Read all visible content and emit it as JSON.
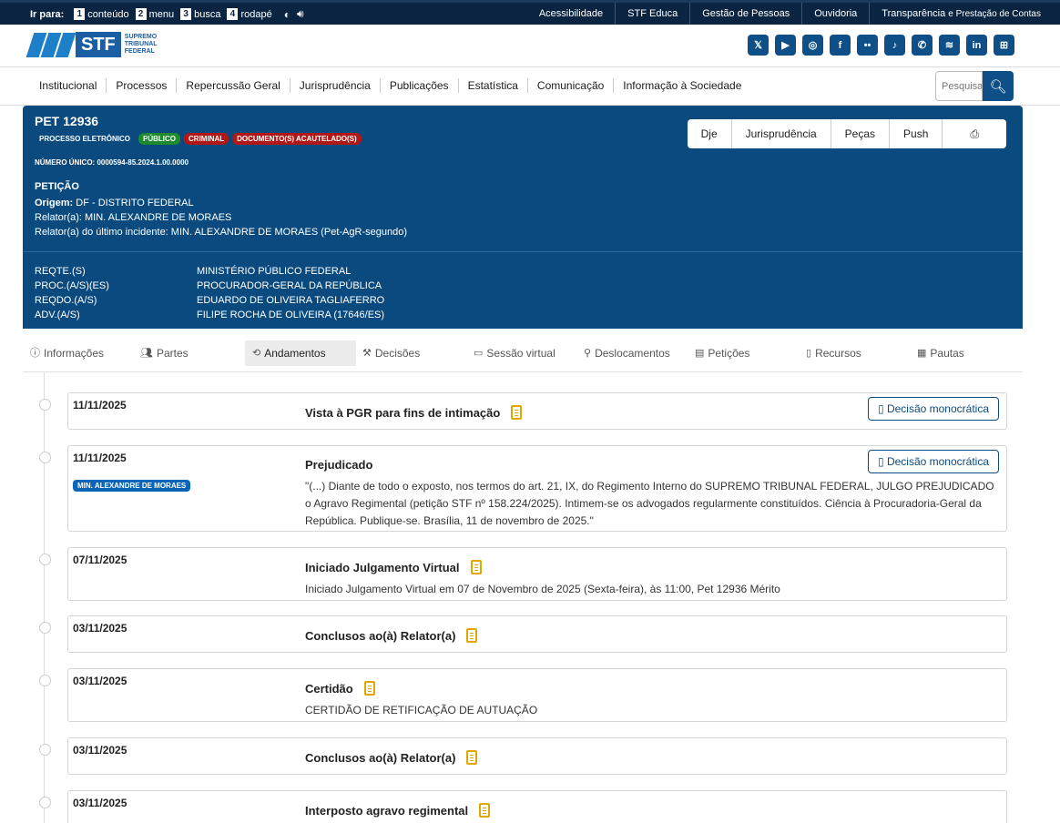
{
  "topbar": {
    "skip_label": "Ir para:",
    "skip": [
      {
        "num": "1",
        "label": "conteúdo"
      },
      {
        "num": "2",
        "label": "menu"
      },
      {
        "num": "3",
        "label": "busca"
      },
      {
        "num": "4",
        "label": "rodapé"
      }
    ],
    "links": [
      "Acessibilidade",
      "STF Educa",
      "Gestão de Pessoas",
      "Ouvidoria"
    ],
    "transparency_main": "Transparência",
    "transparency_small": "e Prestação de Contas"
  },
  "logo": {
    "text": "STF",
    "sub1": "SUPREMO",
    "sub2": "TRIBUNAL",
    "sub3": "FEDERAL"
  },
  "social": [
    "x-icon",
    "youtube-icon",
    "instagram-icon",
    "facebook-icon",
    "flickr-icon",
    "tiktok-icon",
    "whatsapp-icon",
    "spotify-icon",
    "linkedin-icon",
    "grid-icon"
  ],
  "nav": [
    "Institucional",
    "Processos",
    "Repercussão Geral",
    "Jurisprudência",
    "Publicações",
    "Estatística",
    "Comunicação",
    "Informação à Sociedade"
  ],
  "search": {
    "placeholder": "Pesquisar"
  },
  "process": {
    "title": "PET 12936",
    "type": "PROCESSO ELETRÔNICO",
    "badges": [
      "PÚBLICO",
      "CRIMINAL",
      "DOCUMENTO(S) ACAUTELADO(S)"
    ],
    "numero_unico": "NÚMERO ÚNICO: 0000594-85.2024.1.00.0000",
    "classe": "PETIÇÃO",
    "origem_label": "Origem:",
    "origem": "DF - DISTRITO FEDERAL",
    "relator": "Relator(a): MIN. ALEXANDRE DE MORAES",
    "relator_incidente": "Relator(a) do último incidente: MIN. ALEXANDRE DE MORAES (Pet-AgR-segundo)",
    "parties": [
      {
        "role": "REQTE.(S)",
        "name": "MINISTÉRIO PÚBLICO FEDERAL"
      },
      {
        "role": "PROC.(A/S)(ES)",
        "name": "PROCURADOR-GERAL DA REPÚBLICA"
      },
      {
        "role": "REQDO.(A/S)",
        "name": "EDUARDO DE OLIVEIRA TAGLIAFERRO"
      },
      {
        "role": "ADV.(A/S)",
        "name": "FILIPE ROCHA DE OLIVEIRA (17646/ES)"
      }
    ],
    "actions": [
      "Dje",
      "Jurisprudência",
      "Peças",
      "Push"
    ]
  },
  "tabs": [
    "Informações",
    "Partes",
    "Andamentos",
    "Decisões",
    "Sessão virtual",
    "Deslocamentos",
    "Petições",
    "Recursos",
    "Pautas"
  ],
  "entries": [
    {
      "date": "11/11/2025",
      "title": "Vista à PGR para fins de intimação",
      "button": "Decisão monocrática"
    },
    {
      "date": "11/11/2025",
      "title": "Prejudicado",
      "button": "Decisão monocrática",
      "tag": "MIN. ALEXANDRE DE MORAES",
      "desc": "\"(...) Diante de todo o exposto, nos termos do art. 21, IX, do Regimento Interno do SUPREMO TRIBUNAL FEDERAL, JULGO PREJUDICADO o Agravo Regimental (petição STF nº 158.224/2025). Intimem-se os advogados regularmente constituídos. Ciência à Procuradoria-Geral da República. Publique-se. Brasília, 11 de novembro de 2025.\""
    },
    {
      "date": "07/11/2025",
      "title": "Iniciado Julgamento Virtual",
      "desc": "Iniciado Julgamento Virtual em 07 de Novembro de 2025 (Sexta-feira), às 11:00, Pet 12936 Mérito"
    },
    {
      "date": "03/11/2025",
      "title": "Conclusos ao(à) Relator(a)"
    },
    {
      "date": "03/11/2025",
      "title": "Certidão",
      "desc": "CERTIDÃO DE RETIFICAÇÃO DE AUTUAÇÃO"
    },
    {
      "date": "03/11/2025",
      "title": "Conclusos ao(à) Relator(a)"
    },
    {
      "date": "03/11/2025",
      "title": "Interposto agravo regimental"
    }
  ]
}
